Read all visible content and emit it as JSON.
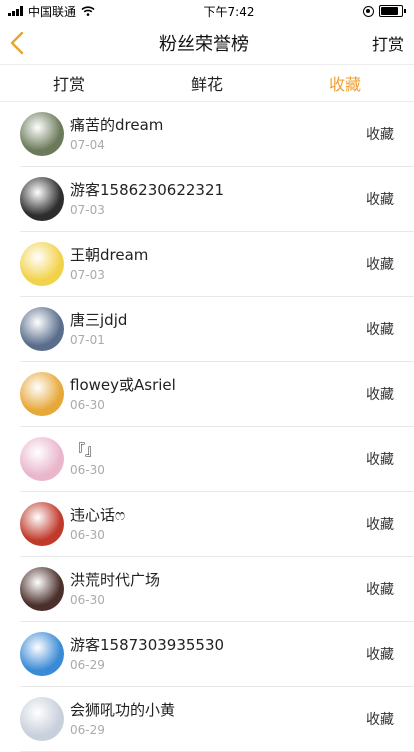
{
  "status": {
    "carrier": "中国联通",
    "time": "下午7:42"
  },
  "nav": {
    "title": "粉丝荣誉榜",
    "action": "打赏"
  },
  "tabs": [
    {
      "label": "打赏",
      "active": false
    },
    {
      "label": "鲜花",
      "active": false
    },
    {
      "label": "收藏",
      "active": true
    }
  ],
  "colors": {
    "accent": "#f0a030",
    "divider": "#e8e8e8"
  },
  "fans": [
    {
      "name": "痛苦的dream",
      "date": "07-04",
      "action": "收藏",
      "avatar_color": "#6b7a5a"
    },
    {
      "name": "游客1586230622321",
      "date": "07-03",
      "action": "收藏",
      "avatar_color": "#2d2d2d"
    },
    {
      "name": "王朝dream",
      "date": "07-03",
      "action": "收藏",
      "avatar_color": "#f2d24a"
    },
    {
      "name": "唐三jdjd",
      "date": "07-01",
      "action": "收藏",
      "avatar_color": "#5a6e8c"
    },
    {
      "name": "flowey或Asriel",
      "date": "06-30",
      "action": "收藏",
      "avatar_color": "#e7a83a"
    },
    {
      "name": "『』",
      "date": "06-30",
      "action": "收藏",
      "avatar_color": "#e9b6cc"
    },
    {
      "name": "违心话ෆ",
      "date": "06-30",
      "action": "收藏",
      "avatar_color": "#c0392b"
    },
    {
      "name": "洪荒时代广场",
      "date": "06-30",
      "action": "收藏",
      "avatar_color": "#4a2f2a"
    },
    {
      "name": "游客1587303935530",
      "date": "06-29",
      "action": "收藏",
      "avatar_color": "#3a8ad6"
    },
    {
      "name": "会狮吼功的小黄",
      "date": "06-29",
      "action": "收藏",
      "avatar_color": "#c8d0dc"
    }
  ]
}
